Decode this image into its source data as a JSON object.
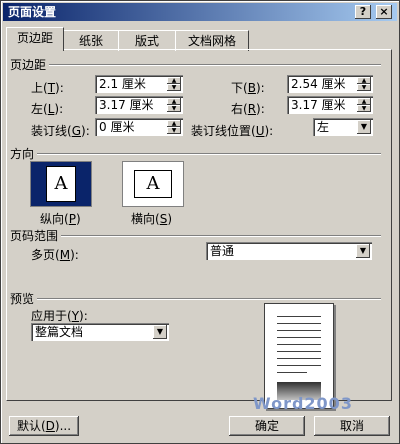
{
  "window": {
    "title": "页面设置",
    "help_btn": "?",
    "close_btn": "×"
  },
  "tabs": [
    {
      "label": "页边距",
      "active": true
    },
    {
      "label": "纸张",
      "active": false
    },
    {
      "label": "版式",
      "active": false
    },
    {
      "label": "文档网格",
      "active": false
    }
  ],
  "margins": {
    "section": "页边距",
    "top": {
      "label": "上",
      "key": "T",
      "value": "2.1 厘米"
    },
    "bottom": {
      "label": "下",
      "key": "B",
      "value": "2.54 厘米"
    },
    "left": {
      "label": "左",
      "key": "L",
      "value": "3.17 厘米"
    },
    "right": {
      "label": "右",
      "key": "R",
      "value": "3.17 厘米"
    },
    "gutter": {
      "label": "装订线",
      "key": "G",
      "value": "0 厘米"
    },
    "gutter_pos": {
      "label": "装订线位置",
      "key": "U",
      "value": "左"
    }
  },
  "orientation": {
    "section": "方向",
    "portrait": {
      "label": "纵向",
      "key": "P",
      "glyph": "A"
    },
    "landscape": {
      "label": "横向",
      "key": "S",
      "glyph": "A"
    }
  },
  "pages": {
    "section": "页码范围",
    "multi_label": "多页",
    "key": "M",
    "value": "普通"
  },
  "preview": {
    "section": "预览",
    "apply_label": "应用于",
    "key": "Y",
    "value": "整篇文档"
  },
  "buttons": {
    "default": "默认",
    "default_key": "D",
    "default_suffix": "...",
    "ok": "确定",
    "cancel": "取消"
  },
  "watermark": "Word2003"
}
